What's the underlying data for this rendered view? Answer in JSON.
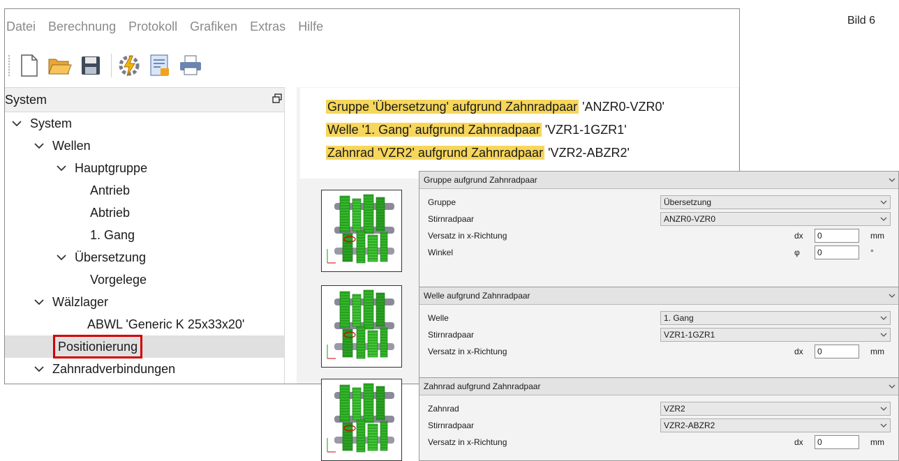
{
  "figure_label": "Bild 6",
  "menu": [
    "Datei",
    "Berechnung",
    "Protokoll",
    "Grafiken",
    "Extras",
    "Hilfe"
  ],
  "toolbar_icons": [
    "new-document-icon",
    "open-folder-icon",
    "save-icon",
    "calculate-icon",
    "report-icon",
    "print-icon"
  ],
  "panel": {
    "title": "System"
  },
  "tree": [
    {
      "label": "System",
      "level": 0,
      "expanded": true
    },
    {
      "label": "Wellen",
      "level": 1,
      "expanded": true
    },
    {
      "label": "Hauptgruppe",
      "level": 2,
      "expanded": true
    },
    {
      "label": "Antrieb",
      "level": 3
    },
    {
      "label": "Abtrieb",
      "level": 3
    },
    {
      "label": "1. Gang",
      "level": 3
    },
    {
      "label": "Übersetzung",
      "level": 2,
      "expanded": true
    },
    {
      "label": "Vorgelege",
      "level": 3
    },
    {
      "label": "Wälzlager",
      "level": 1,
      "expanded": true
    },
    {
      "label": "ABWL 'Generic K 25x33x20'",
      "level": 2
    },
    {
      "label": "Positionierung",
      "level": 1,
      "selected": true
    },
    {
      "label": "Zahnradverbindungen",
      "level": 1,
      "expanded": true
    }
  ],
  "headline": [
    {
      "highlight": "Gruppe 'Übersetzung' aufgrund Zahnradpaar",
      "rest": " 'ANZR0-VZR0'"
    },
    {
      "highlight": "Welle '1. Gang' aufgrund Zahnradpaar",
      "rest": " 'VZR1-1GZR1'"
    },
    {
      "highlight": "Zahnrad 'VZR2' aufgrund Zahnradpaar",
      "rest": " 'VZR2-ABZR2'"
    }
  ],
  "dialogs": [
    {
      "title": "Gruppe aufgrund Zahnradpaar",
      "rows": [
        {
          "label": "Gruppe",
          "select": "Übersetzung"
        },
        {
          "label": "Stirnradpaar",
          "select": "ANZR0-VZR0"
        },
        {
          "label": "Versatz in x-Richtung",
          "symbol": "dx",
          "value": "0",
          "unit": "mm"
        },
        {
          "label": "Winkel",
          "symbol": "φ",
          "value": "0",
          "unit": "°"
        }
      ]
    },
    {
      "title": "Welle aufgrund Zahnradpaar",
      "rows": [
        {
          "label": "Welle",
          "select": "1. Gang"
        },
        {
          "label": "Stirnradpaar",
          "select": "VZR1-1GZR1"
        },
        {
          "label": "Versatz in x-Richtung",
          "symbol": "dx",
          "value": "0",
          "unit": "mm"
        }
      ]
    },
    {
      "title": "Zahnrad aufgrund Zahnradpaar",
      "rows": [
        {
          "label": "Zahnrad",
          "select": "VZR2"
        },
        {
          "label": "Stirnradpaar",
          "select": "VZR2-ABZR2"
        },
        {
          "label": "Versatz in x-Richtung",
          "symbol": "dx",
          "value": "0",
          "unit": "mm"
        }
      ]
    }
  ],
  "colors": {
    "highlight": "#f6d65b",
    "selection_border": "#d10000",
    "gear_green": "#33b82a"
  }
}
